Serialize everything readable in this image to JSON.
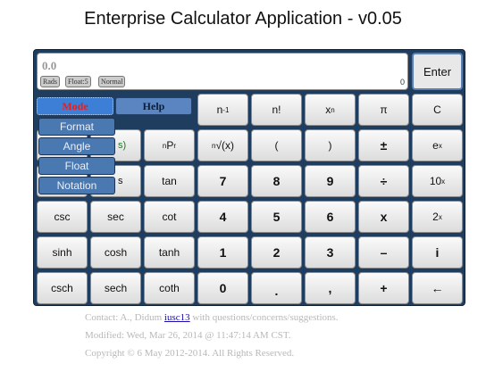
{
  "title": "Enterprise Calculator Application - v0.05",
  "display": {
    "value": "0.0",
    "badges": [
      "Rads",
      "Float:5",
      "Normal"
    ],
    "count": "0"
  },
  "enter_label": "Enter",
  "menu": {
    "mode": "Mode",
    "help": "Help",
    "dropdown": [
      "Format",
      "Angle",
      "Float",
      "Notation"
    ]
  },
  "keys": {
    "row1": [
      "n",
      "n!",
      "x",
      "π",
      "C"
    ],
    "row1_sup": {
      "n": "-1",
      "x": "n"
    },
    "row2": [
      "P",
      "√(x)",
      "(",
      ")",
      "±",
      "e"
    ],
    "row2_extra": {
      "npr_sub_left": "n",
      "npr_sub_right": "r",
      "root_sup": "n",
      "e_sup": "x"
    },
    "row2_partial_left": "s)",
    "row3_partial_left": "s",
    "row3": [
      "tan",
      "7",
      "8",
      "9",
      "÷",
      "10"
    ],
    "row3_sup": {
      "10": "x"
    },
    "row4": [
      "csc",
      "sec",
      "cot",
      "4",
      "5",
      "6",
      "x",
      "2"
    ],
    "row4_sup": {
      "2": "x"
    },
    "row5": [
      "sinh",
      "cosh",
      "tanh",
      "1",
      "2",
      "3",
      "–",
      "i"
    ],
    "row6": [
      "csch",
      "sech",
      "coth",
      "0",
      ".",
      ",",
      "+",
      "←"
    ]
  },
  "footer": {
    "contact_prefix": "Contact: A., Didum ",
    "contact_link": "iusc13",
    "contact_suffix": " with questions/concerns/suggestions.",
    "modified": "Modified: Wed, Mar 26, 2014 @ 11:47:14 AM CST.",
    "copyright": "Copyright © 6 May 2012-2014. All Rights Reserved."
  },
  "colors": {
    "panel": "#1f3d5e",
    "mode_bg": "#3d7fd6",
    "mode_text": "#e61e1e",
    "dropdown_bg": "#4a78b0"
  }
}
